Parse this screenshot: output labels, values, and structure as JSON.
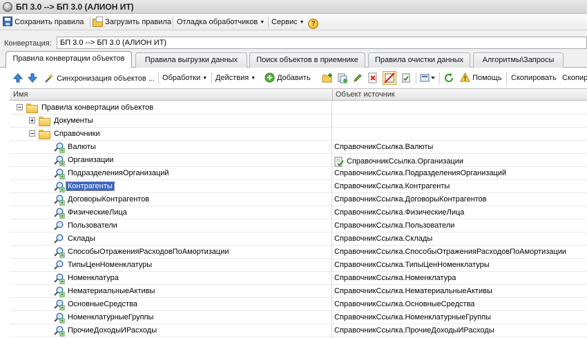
{
  "window": {
    "title": "БП 3.0 --> БП 3.0 (АЛИОН ИТ)"
  },
  "menubar": {
    "save_rules": "Сохранить правила",
    "load_rules": "Загрузить правила",
    "debug_handlers": "Отладка обработчиков",
    "service": "Сервис",
    "help_glyph": "?"
  },
  "conversion": {
    "label": "Конвертация:",
    "value": "БП 3.0 --> БП 3.0 (АЛИОН ИТ)"
  },
  "tabs": [
    {
      "label": "Правила конвертации объектов",
      "active": true
    },
    {
      "label": "Правила выгрузки данных"
    },
    {
      "label": "Поиск объектов в приемнике"
    },
    {
      "label": "Правила очистки данных"
    },
    {
      "label": "Алгоритмы\\Запросы"
    }
  ],
  "toolbar": {
    "sync_objects": "Синхронизация объектов ...",
    "processing": "Обработки",
    "actions": "Действия",
    "add": "Добавить",
    "help": "Помощь",
    "copy": "Скопировать",
    "copy_cut": "Скопир"
  },
  "grid": {
    "columns": {
      "name": "Имя",
      "source": "Объект источник"
    },
    "rows": [
      {
        "name": "Правила конвертации объектов",
        "source": "",
        "level": 0,
        "kind": "folder",
        "expander": "minus"
      },
      {
        "name": "Документы",
        "source": "",
        "level": 1,
        "kind": "folder",
        "expander": "plus"
      },
      {
        "name": "Справочники",
        "source": "",
        "level": 1,
        "kind": "folder",
        "expander": "minus"
      },
      {
        "name": "Валюты",
        "source": "СправочникСсылка.Валюты",
        "level": 2,
        "kind": "rule-plus"
      },
      {
        "name": "Организации",
        "source": "СправочникСсылка.Организации",
        "level": 2,
        "kind": "rule-plus",
        "source_icon": true
      },
      {
        "name": "ПодразделенияОрганизаций",
        "source": "СправочникСсылка.ПодразделенияОрганизаций",
        "level": 2,
        "kind": "rule-plus"
      },
      {
        "name": "Контрагенты",
        "source": "СправочникСсылка.Контрагенты",
        "level": 2,
        "kind": "rule-plus",
        "selected": true
      },
      {
        "name": "ДоговорыКонтрагентов",
        "source": "СправочникСсылка.ДоговорыКонтрагентов",
        "level": 2,
        "kind": "rule-plus"
      },
      {
        "name": "ФизическиеЛица",
        "source": "СправочникСсылка.ФизическиеЛица",
        "level": 2,
        "kind": "rule-plus"
      },
      {
        "name": "Пользователи",
        "source": "СправочникСсылка.Пользователи",
        "level": 2,
        "kind": "rule"
      },
      {
        "name": "Склады",
        "source": "СправочникСсылка.Склады",
        "level": 2,
        "kind": "rule"
      },
      {
        "name": "СпособыОтраженияРасходовПоАмортизации",
        "source": "СправочникСсылка.СпособыОтраженияРасходовПоАмортизации",
        "level": 2,
        "kind": "rule-plus"
      },
      {
        "name": "ТипыЦенНоменклатуры",
        "source": "СправочникСсылка.ТипыЦенНоменклатуры",
        "level": 2,
        "kind": "rule"
      },
      {
        "name": "Номенклатура",
        "source": "СправочникСсылка.Номенклатура",
        "level": 2,
        "kind": "rule-plus"
      },
      {
        "name": "НематериальныеАктивы",
        "source": "СправочникСсылка.НематериальныеАктивы",
        "level": 2,
        "kind": "rule-plus"
      },
      {
        "name": "ОсновныеСредства",
        "source": "СправочникСсылка.ОсновныеСредства",
        "level": 2,
        "kind": "rule-plus"
      },
      {
        "name": "НоменклатурныеГруппы",
        "source": "СправочникСсылка.НоменклатурныеГруппы",
        "level": 2,
        "kind": "rule-plus"
      },
      {
        "name": "ПрочиеДоходыИРасходы",
        "source": "СправочникСсылка.ПрочиеДоходыИРасходы",
        "level": 2,
        "kind": "rule-plus"
      }
    ]
  }
}
